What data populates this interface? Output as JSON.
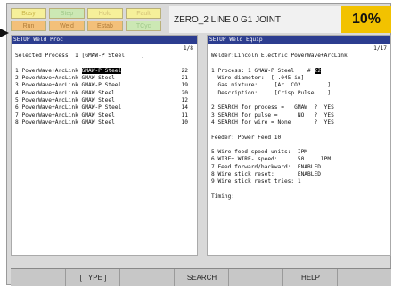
{
  "colors": {
    "led_yellow": "#f6f09a",
    "led_green": "#cce8b4",
    "led_orange": "#f3c07a",
    "accent": "#f2c200",
    "pane_head": "#2c3d8f"
  },
  "status": {
    "row1": [
      "Busy",
      "Step",
      "Hold",
      "Fault"
    ],
    "row2": [
      "Run",
      "Weld",
      "Estab",
      "TCyc"
    ]
  },
  "header": {
    "title": "ZERO_2 LINE 0  G1  JOINT",
    "percent": "10%"
  },
  "left": {
    "header": "SETUP Weld Proc",
    "page": "1/8",
    "selected": "Selected Process: 1 [GMAW-P Steel     ]",
    "items": [
      {
        "n": "1",
        "name": "PowerWave+ArcLink",
        "proc": "GMAW-P Steel",
        "val": "22",
        "highlight": true
      },
      {
        "n": "2",
        "name": "PowerWave+ArcLink",
        "proc": "GMAW Steel",
        "val": "21"
      },
      {
        "n": "3",
        "name": "PowerWave+ArcLink",
        "proc": "GMAW-P Steel",
        "val": "19"
      },
      {
        "n": "4",
        "name": "PowerWave+ArcLink",
        "proc": "GMAW Steel",
        "val": "20"
      },
      {
        "n": "5",
        "name": "PowerWave+ArcLink",
        "proc": "GMAW Steel",
        "val": "12"
      },
      {
        "n": "6",
        "name": "PowerWave+ArcLink",
        "proc": "GMAW-P Steel",
        "val": "14"
      },
      {
        "n": "7",
        "name": "PowerWave+ArcLink",
        "proc": "GMAW Steel",
        "val": "11"
      },
      {
        "n": "8",
        "name": "PowerWave+ArcLink",
        "proc": "GMAW Steel",
        "val": "10"
      }
    ]
  },
  "right": {
    "header": "SETUP Weld Equip",
    "page": "1/17",
    "welder": "Welder:Lincoln Electric PowerWave+ArcLink",
    "process_line": "1 Process: 1 GMAW-P Steel    #",
    "process_num": "22",
    "wire_diameter": "  Wire diameter:  [ .045 in]",
    "gas": "  Gas mixture:     [Ar  CO2        ]",
    "desc": "  Description:     [Crisp Pulse    ]",
    "search": [
      "2 SEARCH for process =   GMAW  ?  YES",
      "3 SEARCH for pulse =      NO   ?  YES",
      "4 SEARCH for wire = None       ?  YES"
    ],
    "feeder": "Feeder: Power Feed 10",
    "settings": [
      "5 Wire feed speed units:  IPM",
      "6 WIRE+ WIRE- speed:      50     IPM",
      "7 Feed forward/backward:  ENABLED",
      "8 Wire stick reset:       ENABLED",
      "9 Wire stick reset tries: 1"
    ],
    "timing": "Timing:"
  },
  "softkeys": [
    "",
    "[ TYPE ]",
    "",
    "SEARCH",
    "",
    "HELP",
    ""
  ]
}
